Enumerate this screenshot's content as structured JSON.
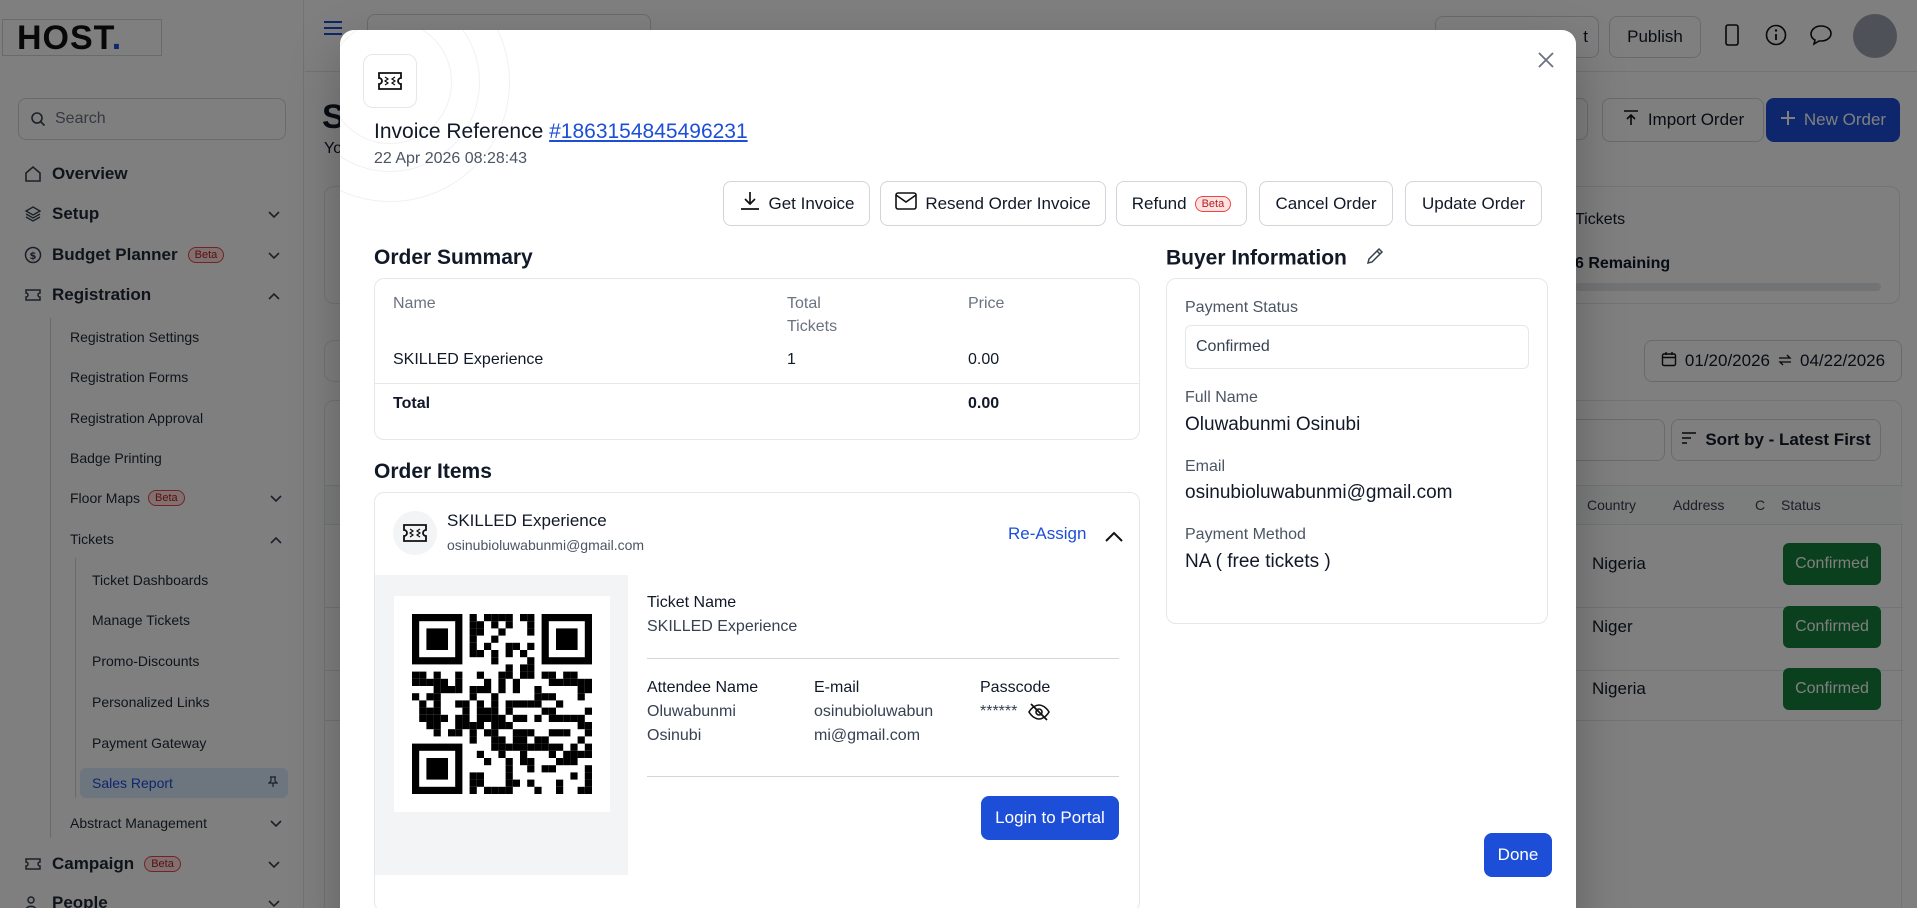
{
  "sidebar": {
    "logo_text": "HOST",
    "logo_dot": ".",
    "search_placeholder": "Search",
    "items": [
      {
        "label": "Overview"
      },
      {
        "label": "Setup"
      },
      {
        "label": "Budget Planner",
        "badge": "Beta"
      },
      {
        "label": "Registration"
      },
      {
        "label": "Campaign",
        "badge": "Beta"
      },
      {
        "label": "People"
      }
    ],
    "registration_sub": [
      {
        "label": "Registration Settings"
      },
      {
        "label": "Registration Forms"
      },
      {
        "label": "Registration Approval"
      },
      {
        "label": "Badge Printing"
      },
      {
        "label": "Floor Maps",
        "badge": "Beta"
      },
      {
        "label": "Tickets"
      },
      {
        "label": "Abstract Management"
      }
    ],
    "tickets_sub": [
      {
        "label": "Ticket Dashboards"
      },
      {
        "label": "Manage Tickets"
      },
      {
        "label": "Promo-Discounts"
      },
      {
        "label": "Personalized Links"
      },
      {
        "label": "Payment Gateway"
      },
      {
        "label": "Sales Report",
        "active": true
      }
    ]
  },
  "background": {
    "topbar": {
      "publish": "Publish",
      "left_partial": "t"
    },
    "page_title_partial": "S",
    "page_sub_partial": "Yo",
    "import_order": "Import Order",
    "new_order": "New Order",
    "tickets_label": "Tickets",
    "remaining": "6 Remaining",
    "date_from": "01/20/2026",
    "date_to": "04/22/2026",
    "sort_by": "Sort by - Latest First",
    "columns": [
      "Country",
      "Address",
      "C",
      "Status"
    ],
    "rows": [
      {
        "country": "Nigeria",
        "status": "Confirmed"
      },
      {
        "country": "Niger",
        "status": "Confirmed"
      },
      {
        "country": "Nigeria",
        "status": "Confirmed"
      }
    ]
  },
  "modal": {
    "invoice_label": "Invoice Reference",
    "invoice_ref": "#1863154845496231",
    "date": "22 Apr 2026 08:28:43",
    "actions": {
      "get_invoice": "Get Invoice",
      "resend": "Resend Order Invoice",
      "refund": "Refund",
      "refund_badge": "Beta",
      "cancel": "Cancel Order",
      "update": "Update Order"
    },
    "order_summary": {
      "title": "Order Summary",
      "headers": {
        "name": "Name",
        "total_tickets_1": "Total",
        "total_tickets_2": "Tickets",
        "price": "Price"
      },
      "row": {
        "name": "SKILLED Experience",
        "tickets": "1",
        "price": "0.00"
      },
      "total_label": "Total",
      "total_value": "0.00"
    },
    "order_items": {
      "title": "Order Items",
      "item_name": "SKILLED Experience",
      "item_email": "osinubioluwabunmi@gmail.com",
      "reassign": "Re-Assign",
      "ticket_name_label": "Ticket Name",
      "ticket_name_value": "SKILLED Experience",
      "attendee_label": "Attendee Name",
      "attendee_line1": "Oluwabunmi",
      "attendee_line2": "Osinubi",
      "email_label": "E-mail",
      "email_line1": "osinubioluwabun",
      "email_line2": "mi@gmail.com",
      "passcode_label": "Passcode",
      "passcode_value": "******",
      "login_btn": "Login to Portal"
    },
    "buyer": {
      "title": "Buyer Information",
      "payment_status_label": "Payment Status",
      "payment_status_value": "Confirmed",
      "full_name_label": "Full Name",
      "full_name_value": "Oluwabunmi Osinubi",
      "email_label": "Email",
      "email_value": "osinubioluwabunmi@gmail.com",
      "payment_method_label": "Payment Method",
      "payment_method_value": "NA ( free tickets )"
    },
    "done": "Done"
  },
  "colors": {
    "primary": "#1d4ed8",
    "success": "#15803d",
    "overlay": "rgba(0,0,0,0.5)"
  }
}
